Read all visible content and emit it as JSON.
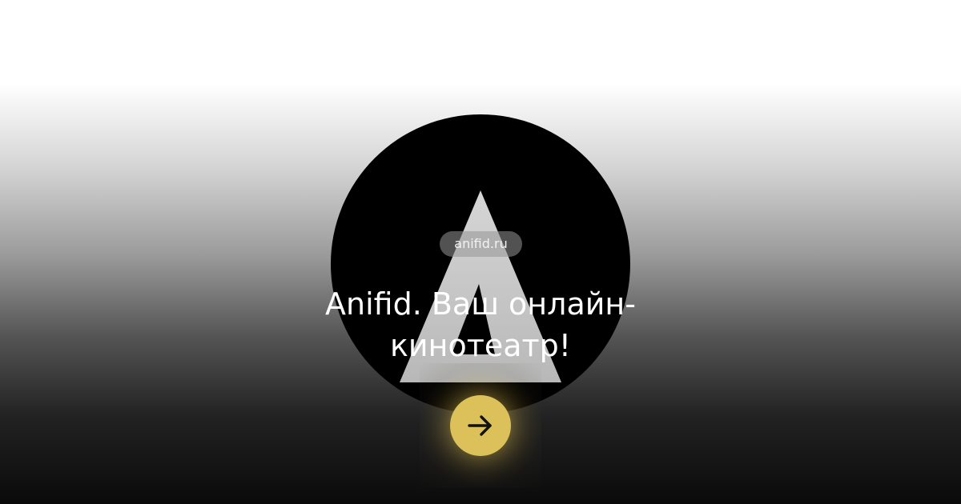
{
  "site": {
    "domain": "anifid.ru",
    "headline": "Anifid. Ваш онлайн-кинотеатр!"
  },
  "logo": {
    "icon": "anifid-logo-icon",
    "circle_color": "#000000",
    "mark_color": "#cfcfcf"
  },
  "action": {
    "icon": "arrow-right-icon",
    "color": "#dcc15a"
  }
}
